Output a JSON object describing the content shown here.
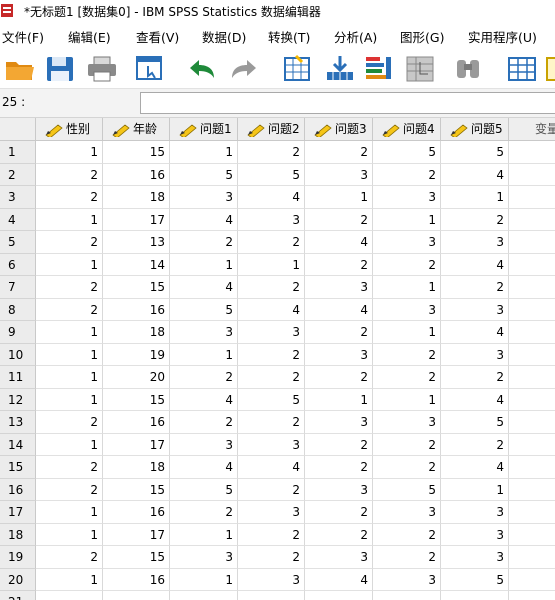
{
  "window": {
    "title": "*无标题1 [数据集0] - IBM SPSS Statistics 数据编辑器"
  },
  "menu": [
    "文件(F)",
    "编辑(E)",
    "查看(V)",
    "数据(D)",
    "转换(T)",
    "分析(A)",
    "图形(G)",
    "实用程序(U)"
  ],
  "toolbar": {
    "buttons": [
      "open-folder-icon",
      "save-icon",
      "print-icon",
      "dialog-recall-icon",
      "undo-icon",
      "redo-icon",
      "goto-case-icon",
      "goto-variable-icon",
      "variables-icon",
      "run-descriptives-icon",
      "find-icon",
      "insert-cases-icon",
      "insert-variable-icon"
    ]
  },
  "cell_editor": {
    "reference": "25 :",
    "value": ""
  },
  "columns": [
    "性别",
    "年龄",
    "问题1",
    "问题2",
    "问题3",
    "问题4",
    "问题5"
  ],
  "extra_column": "变量",
  "rows": [
    [
      1,
      15,
      1,
      2,
      2,
      5,
      5
    ],
    [
      2,
      16,
      5,
      5,
      3,
      2,
      4
    ],
    [
      2,
      18,
      3,
      4,
      1,
      3,
      1
    ],
    [
      1,
      17,
      4,
      3,
      2,
      1,
      2
    ],
    [
      2,
      13,
      2,
      2,
      4,
      3,
      3
    ],
    [
      1,
      14,
      1,
      1,
      2,
      2,
      4
    ],
    [
      2,
      15,
      4,
      2,
      3,
      1,
      2
    ],
    [
      2,
      16,
      5,
      4,
      4,
      3,
      3
    ],
    [
      1,
      18,
      3,
      3,
      2,
      1,
      4
    ],
    [
      1,
      19,
      1,
      2,
      3,
      2,
      3
    ],
    [
      1,
      20,
      2,
      2,
      2,
      2,
      2
    ],
    [
      1,
      15,
      4,
      5,
      1,
      1,
      4
    ],
    [
      2,
      16,
      2,
      2,
      3,
      3,
      5
    ],
    [
      1,
      17,
      3,
      3,
      2,
      2,
      2
    ],
    [
      2,
      18,
      4,
      4,
      2,
      2,
      4
    ],
    [
      2,
      15,
      5,
      2,
      3,
      5,
      1
    ],
    [
      1,
      16,
      2,
      3,
      2,
      3,
      3
    ],
    [
      1,
      17,
      1,
      2,
      2,
      2,
      3
    ],
    [
      2,
      15,
      3,
      2,
      3,
      2,
      3
    ],
    [
      1,
      16,
      1,
      3,
      4,
      3,
      5
    ]
  ],
  "row_numbers": [
    "1",
    "2",
    "3",
    "4",
    "5",
    "6",
    "7",
    "8",
    "9",
    "10",
    "11",
    "12",
    "13",
    "14",
    "15",
    "16",
    "17",
    "18",
    "19",
    "20",
    "21"
  ],
  "colors": {
    "header_bg": "#eeeeee",
    "rownum_bg": "#ececec",
    "pencil_yellow": "#f5c518"
  }
}
